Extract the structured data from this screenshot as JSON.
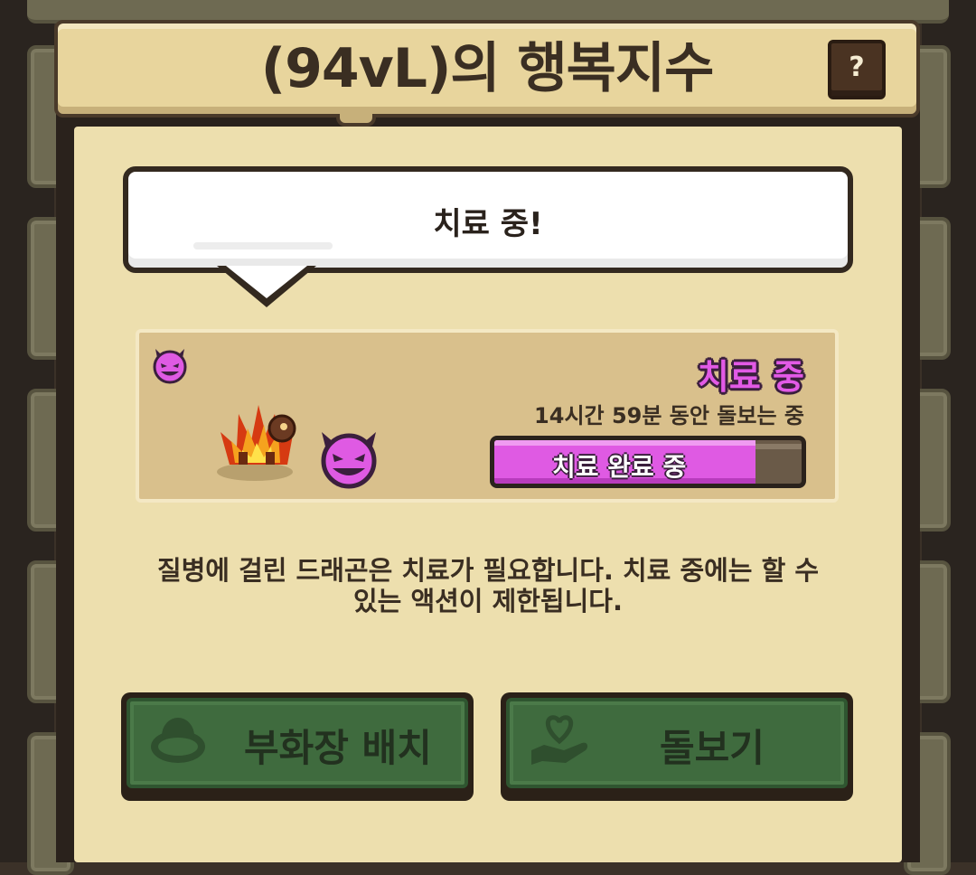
{
  "dialog": {
    "title": "(94vL)의 행복지수",
    "help_label": "?"
  },
  "bubble": {
    "text": "치료 중!"
  },
  "dragon_card": {
    "status_title": "치료 중",
    "care_time": "14시간 59분 동안 돌보는 중",
    "progress": {
      "label": "치료 완료 중",
      "fraction": 0.85,
      "fill_color": "#df5ae3"
    },
    "sick_icon": "devil-face-icon",
    "dragon_icon": "fire-dragon-sprite"
  },
  "description": {
    "line1": "질병에 걸린 드래곤은 치료가 필요합니다. 치료 중에는 할 수",
    "line2": "있는 액션이 제한됩니다."
  },
  "buttons": {
    "hatchery": {
      "label": "부화장 배치",
      "icon": "nest-icon"
    },
    "care": {
      "label": "돌보기",
      "icon": "heart-hand-icon"
    }
  },
  "colors": {
    "accent_sick": "#df5ae3",
    "button_green": "#3f6b3e",
    "panel_bg": "#eddfae"
  }
}
